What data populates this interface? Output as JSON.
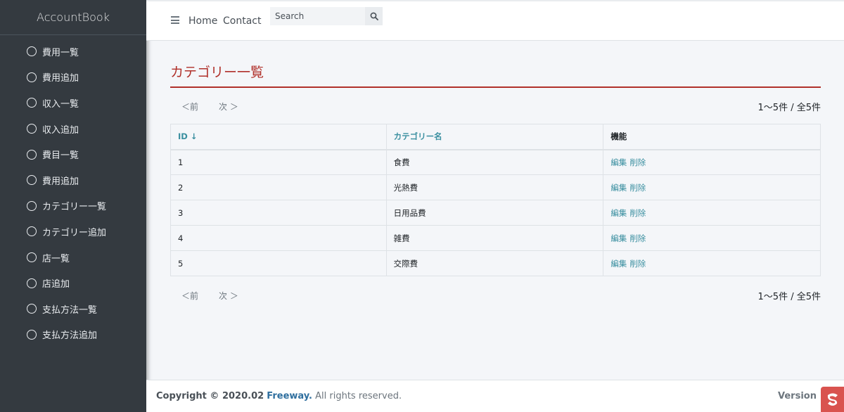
{
  "sidebar": {
    "brand": "AccountBook",
    "items": [
      {
        "label": "費用一覧"
      },
      {
        "label": "費用追加"
      },
      {
        "label": "収入一覧"
      },
      {
        "label": "収入追加"
      },
      {
        "label": "費目一覧"
      },
      {
        "label": "費用追加"
      },
      {
        "label": "カテゴリー一覧"
      },
      {
        "label": "カテゴリー追加"
      },
      {
        "label": "店一覧"
      },
      {
        "label": "店追加"
      },
      {
        "label": "支払方法一覧"
      },
      {
        "label": "支払方法追加"
      }
    ]
  },
  "topbar": {
    "home": "Home",
    "contact": "Contact",
    "search_placeholder": "Search"
  },
  "page": {
    "title": "カテゴリー一覧",
    "prev": "＜前",
    "next": "次 ＞",
    "count": "1〜5件 / 全5件"
  },
  "table": {
    "headers": {
      "id": "ID ↓",
      "name": "カテゴリー名",
      "actions": "機能"
    },
    "rows": [
      {
        "id": "1",
        "name": "食費",
        "edit": "編集",
        "delete": "削除"
      },
      {
        "id": "2",
        "name": "光熱費",
        "edit": "編集",
        "delete": "削除"
      },
      {
        "id": "3",
        "name": "日用品費",
        "edit": "編集",
        "delete": "削除"
      },
      {
        "id": "4",
        "name": "雑費",
        "edit": "編集",
        "delete": "削除"
      },
      {
        "id": "5",
        "name": "交際費",
        "edit": "編集",
        "delete": "削除"
      }
    ]
  },
  "footer": {
    "copyright": "Copyright © 2020.02",
    "company": "Freeway.",
    "rights": "All rights reserved.",
    "version": "Version 1."
  },
  "colors": {
    "sidebar_bg": "#343a40",
    "title_red": "#b0302a",
    "link_teal": "#3a8fa0"
  }
}
